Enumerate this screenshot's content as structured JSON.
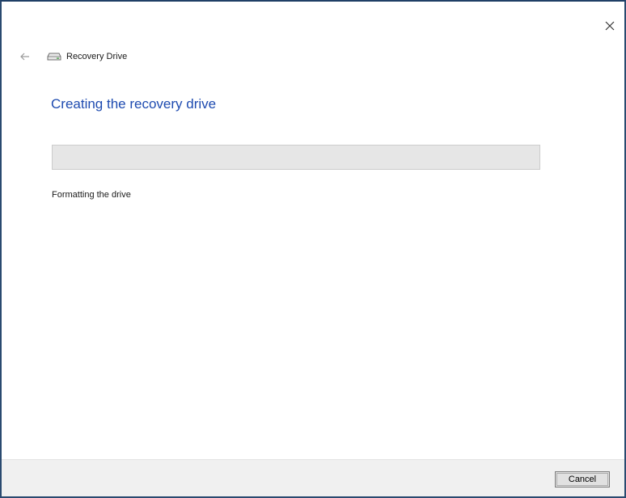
{
  "window": {
    "title": "Recovery Drive",
    "heading": "Creating the recovery drive",
    "status": "Formatting the drive",
    "progress_percent": 0,
    "icons": {
      "back": "back-arrow-icon",
      "app": "drive-icon",
      "close": "close-icon"
    }
  },
  "footer": {
    "cancel_label": "Cancel"
  },
  "colors": {
    "heading": "#1e4bb0",
    "window_border": "#2a4a70",
    "progress_track": "#e6e6e6",
    "footer_bg": "#f0f0f0"
  }
}
